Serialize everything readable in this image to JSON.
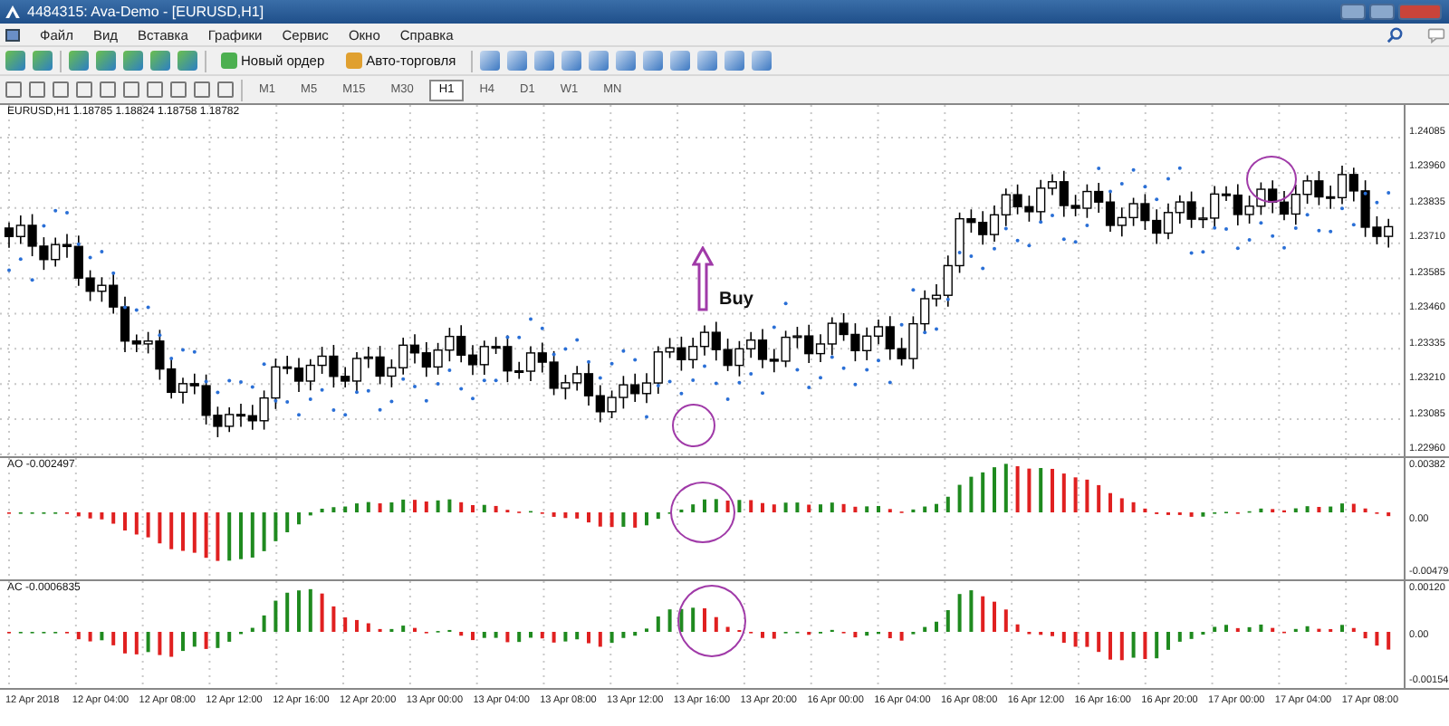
{
  "window": {
    "title": "4484315: Ava-Demo - [EURUSD,H1]"
  },
  "menu": [
    "Файл",
    "Вид",
    "Вставка",
    "Графики",
    "Сервис",
    "Окно",
    "Справка"
  ],
  "toolbar": {
    "buttons": [
      "Новый ордер",
      "Авто-торговля"
    ]
  },
  "timeframes": [
    {
      "label": "M1",
      "selected": false
    },
    {
      "label": "M5",
      "selected": false
    },
    {
      "label": "M15",
      "selected": false
    },
    {
      "label": "M30",
      "selected": false
    },
    {
      "label": "H1",
      "selected": true
    },
    {
      "label": "H4",
      "selected": false
    },
    {
      "label": "D1",
      "selected": false
    },
    {
      "label": "W1",
      "selected": false
    },
    {
      "label": "MN",
      "selected": false
    }
  ],
  "chart": {
    "header": "EURUSD,H1  1.18785 1.18824 1.18758 1.18782",
    "price_ticks": [
      "1.24085",
      "1.23960",
      "1.23835",
      "1.23710",
      "1.23585",
      "1.23460",
      "1.23335",
      "1.23210",
      "1.23085",
      "1.22960"
    ],
    "annotation": "Buy"
  },
  "ao": {
    "label": "AO -0.002497",
    "ticks": [
      "0.00382",
      "0.00",
      "-0.00479"
    ]
  },
  "ac": {
    "label": "AC -0.0006835",
    "ticks": [
      "0.00120",
      "0.00",
      "-0.00154"
    ]
  },
  "time_axis": [
    "12 Apr 2018",
    "12 Apr 04:00",
    "12 Apr 08:00",
    "12 Apr 12:00",
    "12 Apr 16:00",
    "12 Apr 20:00",
    "13 Apr 00:00",
    "13 Apr 04:00",
    "13 Apr 08:00",
    "13 Apr 12:00",
    "13 Apr 16:00",
    "13 Apr 20:00",
    "16 Apr 00:00",
    "16 Apr 04:00",
    "16 Apr 08:00",
    "16 Apr 12:00",
    "16 Apr 16:00",
    "16 Apr 20:00",
    "17 Apr 00:00",
    "17 Apr 04:00",
    "17 Apr 08:00"
  ]
}
